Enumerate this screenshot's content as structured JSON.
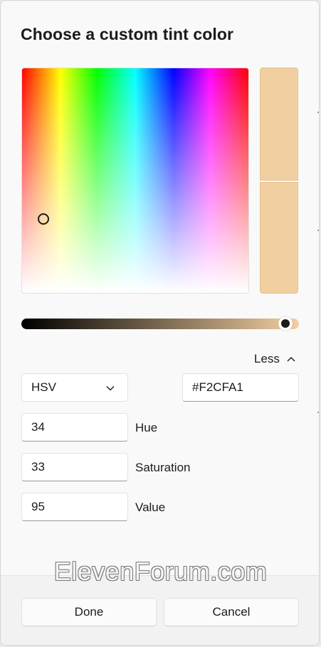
{
  "dialog": {
    "title": "Choose a custom tint color"
  },
  "color": {
    "hex": "#F2CFA1",
    "previous_hex": "#F2CFA1",
    "hue": 34,
    "saturation": 33,
    "value": 95
  },
  "toggle": {
    "label": "Less",
    "icon": "chevron-up-icon"
  },
  "model_select": {
    "selected": "HSV",
    "icon": "chevron-down-icon"
  },
  "fields": {
    "hex_value": "#F2CFA1",
    "hue_value": "34",
    "hue_label": "Hue",
    "saturation_value": "33",
    "saturation_label": "Saturation",
    "value_value": "95",
    "value_label": "Value"
  },
  "buttons": {
    "done_label": "Done",
    "cancel_label": "Cancel"
  },
  "watermark": "ElevenForum.com"
}
